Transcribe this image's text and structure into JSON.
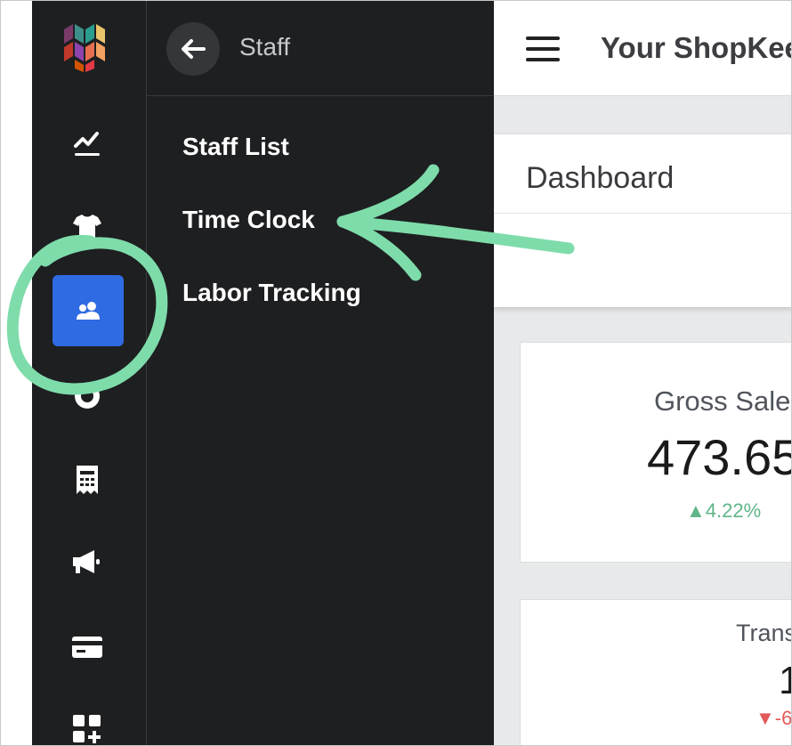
{
  "sidebar": {
    "icons": [
      {
        "name": "logo"
      },
      {
        "name": "reports-chart-icon"
      },
      {
        "name": "inventory-shirt-icon"
      },
      {
        "name": "staff-people-icon",
        "active": true
      },
      {
        "name": "customers-icon"
      },
      {
        "name": "register-receipt-icon"
      },
      {
        "name": "marketing-megaphone-icon"
      },
      {
        "name": "payments-card-icon"
      },
      {
        "name": "addons-apps-icon"
      }
    ],
    "active_color": "#2f6be3"
  },
  "submenu": {
    "title": "Staff",
    "items": [
      {
        "label": "Staff List"
      },
      {
        "label": "Time Clock"
      },
      {
        "label": "Labor Tracking"
      }
    ]
  },
  "header": {
    "store_title": "Your ShopKee"
  },
  "dashboard": {
    "title": "Dashboard",
    "cards": [
      {
        "label": "Gross Sales",
        "value": "473.65",
        "change": "▲4.22%",
        "change_color": "#5fb58a"
      },
      {
        "label": "Trans",
        "value": "1",
        "change": "▼-6",
        "change_color": "#e25a5a"
      }
    ]
  },
  "annotation": {
    "color": "#7edcab"
  }
}
